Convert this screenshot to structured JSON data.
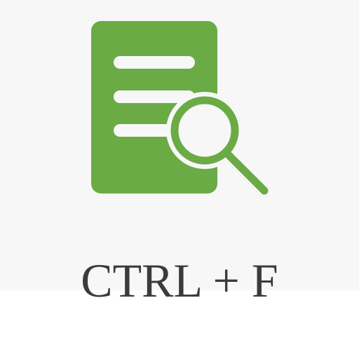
{
  "caption": "CTRL + F",
  "icon": {
    "name": "document-search-icon",
    "color": "#6aab45",
    "background": "#f7f7f7"
  },
  "colors": {
    "panel": "#f7f7f7",
    "page": "#ffffff",
    "text": "#3b3b3b"
  }
}
